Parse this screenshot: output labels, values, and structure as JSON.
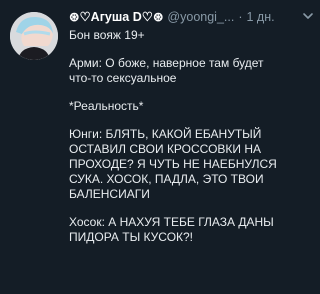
{
  "tweet": {
    "display_name": "⊛♡Агуша D♡⊛",
    "handle": "@yoongi_...",
    "separator": "·",
    "time": "1 дн.",
    "paragraphs": [
      "Бон вояж 19+",
      "Арми: О боже, наверное там будет\nчто-то сексуальное",
      "*Реальность*",
      "Юнги: БЛЯТЬ, КАКОЙ ЕБАНУТЫЙ\nОСТАВИЛ СВОИ КРОССОВКИ НА\nПРОХОДЕ? Я ЧУТЬ НЕ НАЕБНУЛСЯ\nСУКА. ХОСОК, ПАДЛА, ЭТО ТВОИ\nБАЛЕНСИАГИ",
      "Хосок: А НАХУЯ ТЕБЕ ГЛАЗА ДАНЫ\nПИДОРА ТЫ КУСОК?!"
    ]
  },
  "icons": {
    "avatar": "profile-avatar",
    "more": "chevron-down-icon"
  },
  "colors": {
    "background": "#141d26",
    "text": "#e8ecef",
    "muted": "#8899a6"
  }
}
